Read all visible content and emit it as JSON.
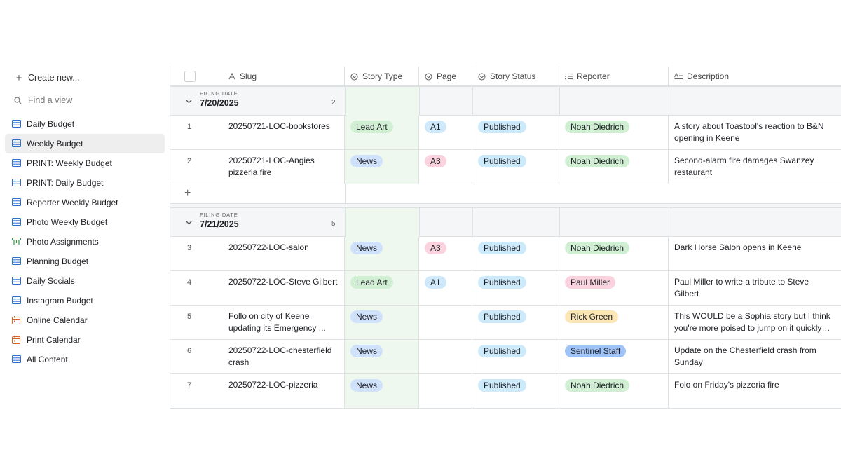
{
  "sidebar": {
    "create_label": "Create new...",
    "find_placeholder": "Find a view",
    "views": [
      {
        "label": "Daily Budget",
        "icon": "grid-icon",
        "active": false
      },
      {
        "label": "Weekly Budget",
        "icon": "grid-icon",
        "active": true
      },
      {
        "label": "PRINT: Weekly Budget",
        "icon": "grid-icon",
        "active": false
      },
      {
        "label": "PRINT: Daily Budget",
        "icon": "grid-icon",
        "active": false
      },
      {
        "label": "Reporter Weekly Budget",
        "icon": "grid-icon",
        "active": false
      },
      {
        "label": "Photo Weekly Budget",
        "icon": "grid-icon",
        "active": false
      },
      {
        "label": "Photo Assignments",
        "icon": "kanban-icon",
        "active": false
      },
      {
        "label": "Planning Budget",
        "icon": "grid-icon",
        "active": false
      },
      {
        "label": "Daily Socials",
        "icon": "grid-icon",
        "active": false
      },
      {
        "label": "Instagram Budget",
        "icon": "grid-icon",
        "active": false
      },
      {
        "label": "Online Calendar",
        "icon": "calendar-icon",
        "active": false
      },
      {
        "label": "Print Calendar",
        "icon": "calendar-icon",
        "active": false
      },
      {
        "label": "All Content",
        "icon": "grid-icon",
        "active": false
      }
    ]
  },
  "columns": {
    "slug": "Slug",
    "story_type": "Story Type",
    "page": "Page",
    "story_status": "Story Status",
    "reporter": "Reporter",
    "description": "Description"
  },
  "groups": [
    {
      "label": "FILING DATE",
      "date": "7/20/2025",
      "count": "2",
      "rows": [
        {
          "num": "1",
          "slug": "20250721-LOC-bookstores",
          "type": "Lead Art",
          "page": "A1",
          "status": "Published",
          "reporter": "Noah Diedrich",
          "description": "A story about Toastool's reaction to B&N opening in Keene"
        },
        {
          "num": "2",
          "slug": "20250721-LOC-Angies pizzeria fire",
          "type": "News",
          "page": "A3",
          "status": "Published",
          "reporter": "Noah Diedrich",
          "description": "Second-alarm fire damages Swanzey restaurant"
        }
      ]
    },
    {
      "label": "FILING DATE",
      "date": "7/21/2025",
      "count": "5",
      "rows": [
        {
          "num": "3",
          "slug": "20250722-LOC-salon",
          "type": "News",
          "page": "A3",
          "status": "Published",
          "reporter": "Noah Diedrich",
          "description": "Dark Horse Salon opens in Keene"
        },
        {
          "num": "4",
          "slug": "20250722-LOC-Steve Gilbert",
          "type": "Lead Art",
          "page": "A1",
          "status": "Published",
          "reporter": "Paul Miller",
          "description": "Paul Miller to write a tribute to Steve Gilbert"
        },
        {
          "num": "5",
          "slug": "Follo on city of Keene updating its Emergency ...",
          "type": "News",
          "page": "",
          "status": "Published",
          "reporter": "Rick Green",
          "description": "This WOULD be a Sophia story but I think you're more poised to jump on it quickly th..."
        },
        {
          "num": "6",
          "slug": "20250722-LOC-chesterfield crash",
          "type": "News",
          "page": "",
          "status": "Published",
          "reporter": "Sentinel Staff",
          "description": "Update on the Chesterfield crash from Sunday"
        },
        {
          "num": "7",
          "slug": "20250722-LOC-pizzeria",
          "type": "News",
          "page": "",
          "status": "Published",
          "reporter": "Noah Diedrich",
          "description": "Folo on Friday's pizzeria fire"
        }
      ]
    }
  ],
  "pill_colors": {
    "Lead Art": "#d1f0d3",
    "News": "#d0e2fb",
    "A1": "#cfe9fb",
    "A3": "#fbd3df",
    "Published": "#cdeafb",
    "Noah Diedrich": "#d1f0d3",
    "Paul Miller": "#fbd3df",
    "Rick Green": "#fbe6b5",
    "Sentinel Staff": "#9fc3f7"
  }
}
